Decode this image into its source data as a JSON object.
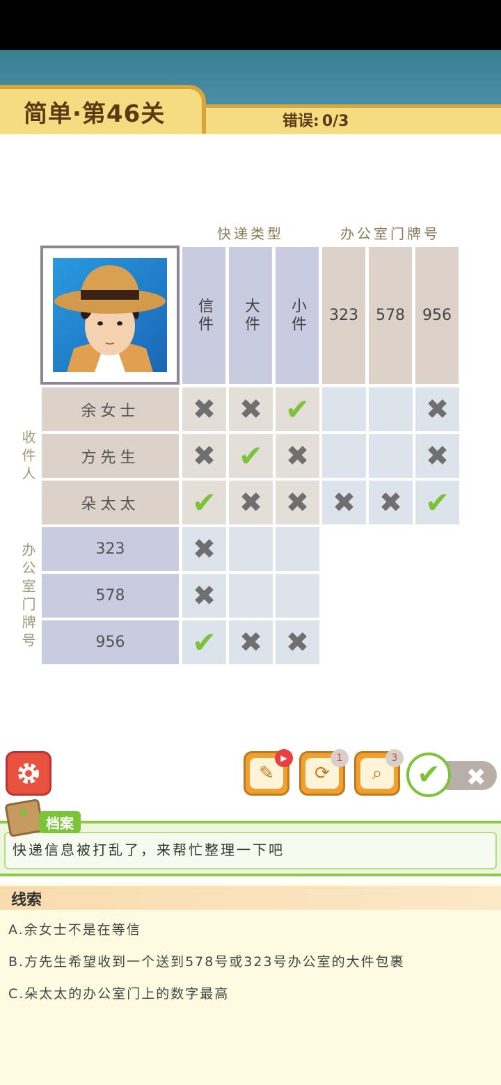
{
  "header": {
    "level_title": "简单·第46关",
    "errors_label": "错误:",
    "errors_value": "0/3"
  },
  "grid": {
    "type_group": "快递类型",
    "office_group": "办公室门牌号",
    "type_cols": [
      "信件",
      "大件",
      "小件"
    ],
    "office_cols": [
      "323",
      "578",
      "956"
    ],
    "recipient_side": "收件人",
    "office_side": "办公室门牌号",
    "recipients": [
      "余女士",
      "方先生",
      "朵太太"
    ],
    "office_rows": [
      "323",
      "578",
      "956"
    ],
    "recipient_type_marks": [
      [
        "x",
        "x",
        "v"
      ],
      [
        "x",
        "v",
        "x"
      ],
      [
        "v",
        "x",
        "x"
      ]
    ],
    "recipient_office_marks": [
      [
        "",
        "",
        "x"
      ],
      [
        "",
        "",
        "x"
      ],
      [
        "x",
        "x",
        "v"
      ]
    ],
    "office_type_marks": [
      [
        "x",
        "",
        ""
      ],
      [
        "x",
        "",
        ""
      ],
      [
        "v",
        "x",
        "x"
      ]
    ]
  },
  "toolbar": {
    "badge_notes": "",
    "badge_refresh": "1",
    "badge_hint": "3",
    "settings_icon": "gear-icon",
    "notes_icon": "notepad-icon",
    "refresh_icon": "refresh-icon",
    "hint_icon": "magnifier-icon",
    "toggle_on": "check-icon",
    "toggle_off": "x-icon"
  },
  "archive": {
    "tab_label": "档案",
    "text": "快递信息被打乱了，来帮忙整理一下吧"
  },
  "clues": {
    "title": "线索",
    "items": [
      "A.余女士不是在等信",
      "B.方先生希望收到一个送到578号或323号办公室的大件包裹",
      "C.朵太太的办公室门上的数字最高"
    ]
  },
  "colors": {
    "accent_yellow": "#f6dc80",
    "check_green": "#7cc33a",
    "mark_gray": "#6f6f6f"
  }
}
